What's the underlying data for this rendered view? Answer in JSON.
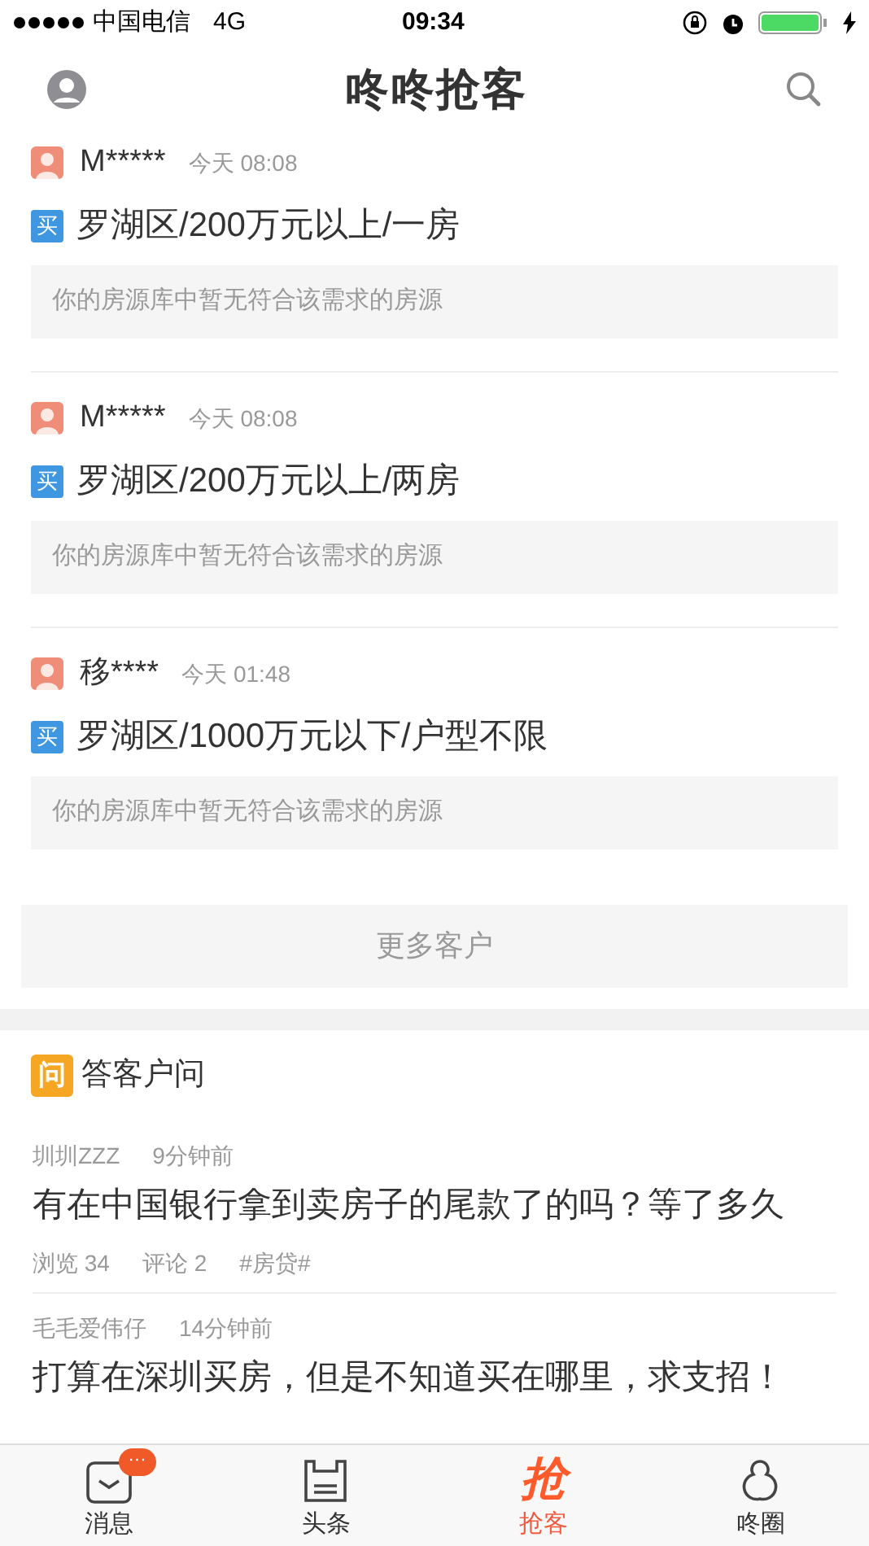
{
  "status_bar": {
    "carrier": "中国电信",
    "network": "4G",
    "time": "09:34"
  },
  "header": {
    "title": "咚咚抢客"
  },
  "demands": [
    {
      "user": "M*****",
      "time": "今天 08:08",
      "tag": "买",
      "title": "罗湖区/200万元以上/一房",
      "notice": "你的房源库中暂无符合该需求的房源"
    },
    {
      "user": "M*****",
      "time": "今天 08:08",
      "tag": "买",
      "title": "罗湖区/200万元以上/两房",
      "notice": "你的房源库中暂无符合该需求的房源"
    },
    {
      "user": "移****",
      "time": "今天 01:48",
      "tag": "买",
      "title": "罗湖区/1000万元以下/户型不限",
      "notice": "你的房源库中暂无符合该需求的房源"
    }
  ],
  "more_button": "更多客户",
  "qa_section": {
    "badge": "问",
    "title": "答客户问",
    "questions": [
      {
        "user": "圳圳ZZZ",
        "time": "9分钟前",
        "title": "有在中国银行拿到卖房子的尾款了的吗？等了多久",
        "views": "浏览 34",
        "comments": "评论 2",
        "topic": "#房贷#"
      },
      {
        "user": "毛毛爱伟仔",
        "time": "14分钟前",
        "title": "打算在深圳买房，但是不知道买在哪里，求支招！"
      }
    ]
  },
  "tab_bar": [
    {
      "kind": "message",
      "label": "消息",
      "selected": false,
      "badge": "···"
    },
    {
      "kind": "news",
      "label": "头条",
      "selected": false
    },
    {
      "kind": "grab",
      "label": "抢客",
      "selected": true,
      "glyph": "抢"
    },
    {
      "kind": "circle",
      "label": "咚圈",
      "selected": false
    }
  ]
}
